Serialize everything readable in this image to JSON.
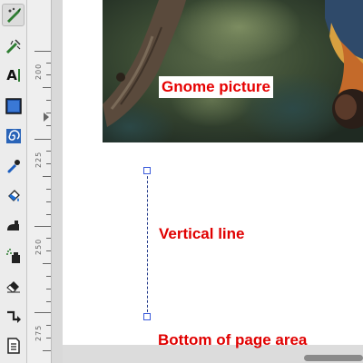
{
  "toolbox": {
    "tools": [
      {
        "icon": "node-edit-icon",
        "active": true
      },
      {
        "icon": "tweak-tool-icon",
        "active": false
      },
      {
        "icon": "text-tool-icon",
        "glyph": "A",
        "active": false
      },
      {
        "icon": "rectangle-tool-icon",
        "active": false
      },
      {
        "icon": "spiral-tool-icon",
        "active": false
      },
      {
        "icon": "dropper-tool-icon",
        "active": false
      },
      {
        "icon": "paint-bucket-icon",
        "active": false
      },
      {
        "icon": "pen-tool-icon",
        "active": false
      },
      {
        "icon": "spray-tool-icon",
        "active": false
      },
      {
        "icon": "eraser-tool-icon",
        "active": false
      },
      {
        "icon": "connector-tool-icon",
        "active": false
      },
      {
        "icon": "document-icon",
        "active": false
      }
    ]
  },
  "ruler": {
    "labels": [
      "200",
      "225",
      "250",
      "275"
    ]
  },
  "canvas": {
    "image_label": "Gnome picture",
    "line_label": "Vertical line",
    "page_bottom_label": "Bottom of page area"
  },
  "colors": {
    "annotation_red": "#e60000",
    "line_blue": "#223a8a",
    "handle_blue": "#3b5bdb"
  }
}
